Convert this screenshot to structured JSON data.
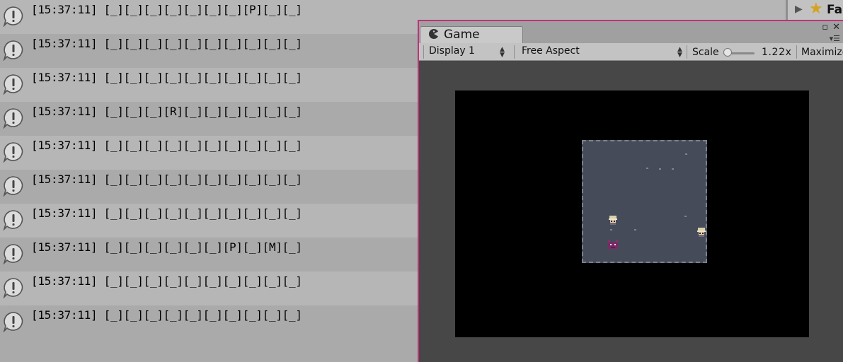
{
  "console": {
    "entries": [
      {
        "text": "[15:37:11] [_][_][_][_][_][_][_][P][_][_]"
      },
      {
        "text": "[15:37:11] [_][_][_][_][_][_][_][_][_][_]"
      },
      {
        "text": "[15:37:11] [_][_][_][_][_][_][_][_][_][_]"
      },
      {
        "text": "[15:37:11] [_][_][_][R][_][_][_][_][_][_]"
      },
      {
        "text": "[15:37:11] [_][_][_][_][_][_][_][_][_][_]"
      },
      {
        "text": "[15:37:11] [_][_][_][_][_][_][_][_][_][_]"
      },
      {
        "text": "[15:37:11] [_][_][_][_][_][_][_][_][_][_]"
      },
      {
        "text": "[15:37:11] [_][_][_][_][_][_][P][_][M][_]"
      },
      {
        "text": "[15:37:11] [_][_][_][_][_][_][_][_][_][_]"
      },
      {
        "text": "[15:37:11] [_][_][_][_][_][_][_][_][_][_]"
      }
    ],
    "entry_icon": "info-bubble-icon"
  },
  "hierarchy": {
    "label": "Fa",
    "icons": [
      "expand-triangle-icon",
      "star-icon"
    ]
  },
  "game_window": {
    "tab_label": "Game",
    "tab_icon": "pacman-icon",
    "controls": {
      "maximize_glyph": "▫",
      "close_glyph": "✕",
      "menu_glyph": "▾☰"
    },
    "toolbar": {
      "display": "Display 1",
      "aspect": "Free Aspect",
      "scale_label": "Scale",
      "scale_value": "1.22x",
      "scale_level": 0.0,
      "maximize_label": "Maximize"
    },
    "colors": {
      "border_accent": "#c0327a",
      "room_floor": "#464b5a",
      "viewport_bg": "#000000"
    },
    "sprites": [
      "player-sprite",
      "monster-sprite",
      "player-sprite-right"
    ]
  }
}
